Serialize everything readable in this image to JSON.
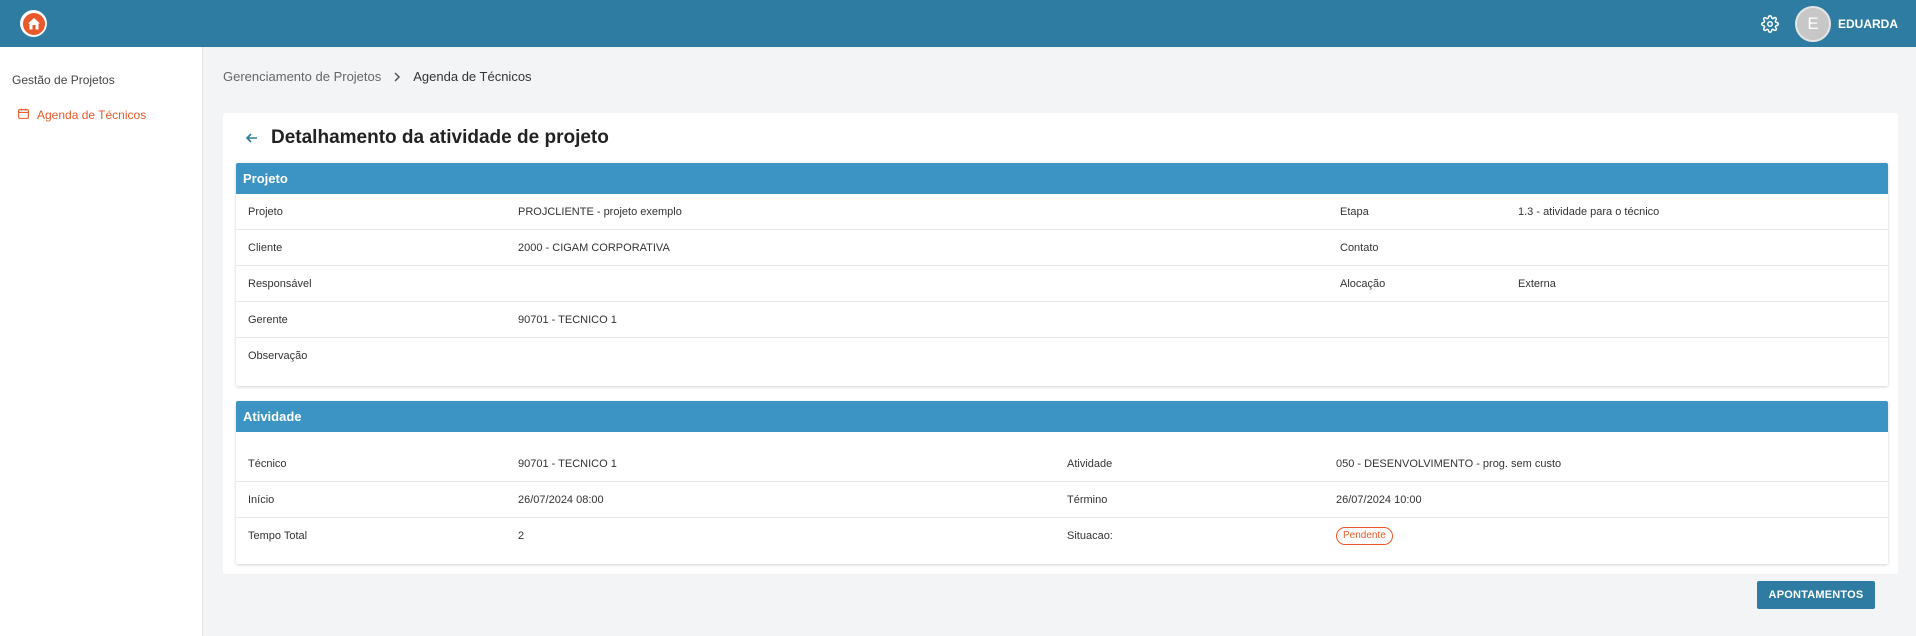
{
  "topbar": {
    "username": "EDUARDA",
    "avatar_initial": "E"
  },
  "sidebar": {
    "section_title": "Gestão de Projetos",
    "items": [
      {
        "label": "Agenda de Técnicos"
      }
    ]
  },
  "breadcrumb": {
    "parent": "Gerenciamento de Projetos",
    "current": "Agenda de Técnicos"
  },
  "page": {
    "title": "Detalhamento da atividade de projeto"
  },
  "projeto": {
    "header": "Projeto",
    "rows": [
      {
        "l1": "Projeto",
        "v1": "PROJCLIENTE - projeto exemplo",
        "l2": "Etapa",
        "v2": "1.3 - atividade para o técnico"
      },
      {
        "l1": "Cliente",
        "v1": "2000 - CIGAM CORPORATIVA",
        "l2": "Contato",
        "v2": ""
      },
      {
        "l1": "Responsável",
        "v1": "",
        "l2": "Alocação",
        "v2": "Externa"
      },
      {
        "l1": "Gerente",
        "v1": "90701 - TECNICO 1",
        "l2": "",
        "v2": ""
      },
      {
        "l1": "Observação",
        "v1": "",
        "l2": "",
        "v2": ""
      }
    ]
  },
  "atividade": {
    "header": "Atividade",
    "rows": [
      {
        "l1": "Técnico",
        "v1": "90701 - TECNICO 1",
        "l2": "Atividade",
        "v2": "050 - DESENVOLVIMENTO - prog. sem custo"
      },
      {
        "l1": "Início",
        "v1": "26/07/2024 08:00",
        "l2": "Término",
        "v2": "26/07/2024 10:00"
      },
      {
        "l1": "Tempo Total",
        "v1": "2",
        "l2": "Situacao:",
        "v2": ""
      }
    ],
    "status_badge": "Pendente"
  },
  "actions": {
    "apontamentos_label": "APONTAMENTOS"
  },
  "colors": {
    "topbar": "#2e7ca1",
    "section_header": "#3b94c3",
    "accent": "#e9582a"
  }
}
